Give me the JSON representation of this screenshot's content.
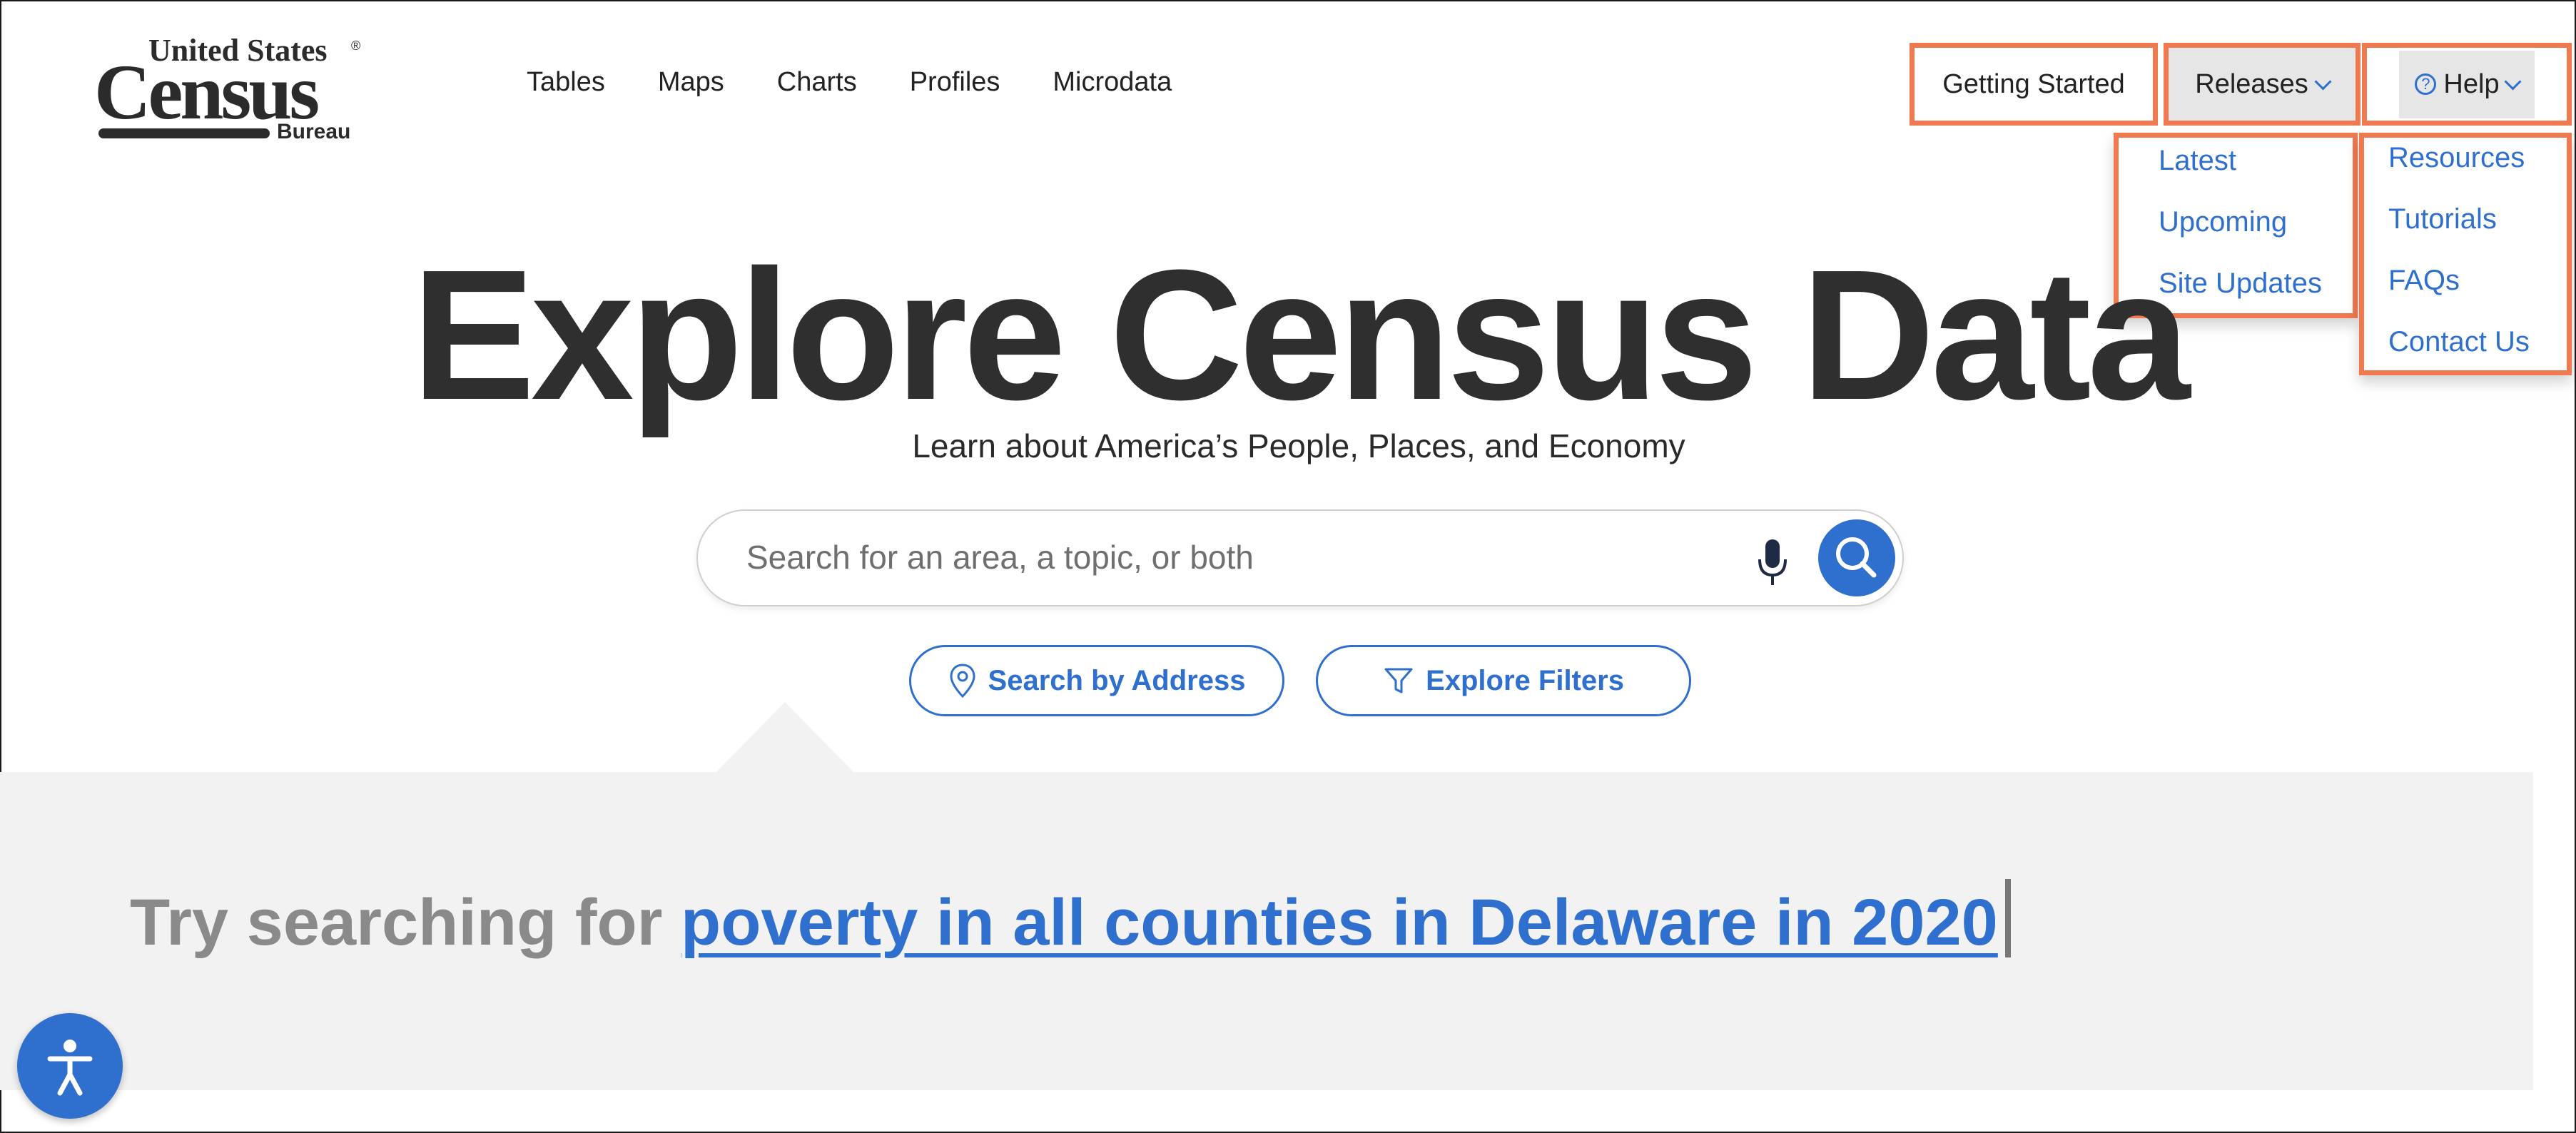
{
  "logo": {
    "top": "United States",
    "reg": "®",
    "main": "Census",
    "sub": "Bureau"
  },
  "nav": {
    "items": [
      "Tables",
      "Maps",
      "Charts",
      "Profiles",
      "Microdata"
    ]
  },
  "top_right": {
    "getting_started": "Getting Started",
    "releases": "Releases",
    "help": "Help",
    "help_icon_glyph": "?"
  },
  "releases_menu": [
    "Latest",
    "Upcoming",
    "Site Updates"
  ],
  "help_menu": [
    "Resources",
    "Tutorials",
    "FAQs",
    "Contact Us"
  ],
  "hero": {
    "title": "Explore Census Data",
    "subtitle": "Learn about America’s People, Places, and Economy"
  },
  "search": {
    "placeholder": "Search for an area, a topic, or both"
  },
  "buttons": {
    "address": "Search by Address",
    "filters": "Explore Filters"
  },
  "suggestion": {
    "prefix": "Try searching for ",
    "link": "poverty in all counties in Delaware in 2020"
  },
  "colors": {
    "accent": "#2f6fce",
    "highlight": "#f0794f",
    "panel": "#f2f2f2"
  },
  "icons": [
    "chevron-down-icon",
    "help-circle-icon",
    "microphone-icon",
    "search-icon",
    "location-pin-icon",
    "filter-icon",
    "accessibility-icon"
  ]
}
